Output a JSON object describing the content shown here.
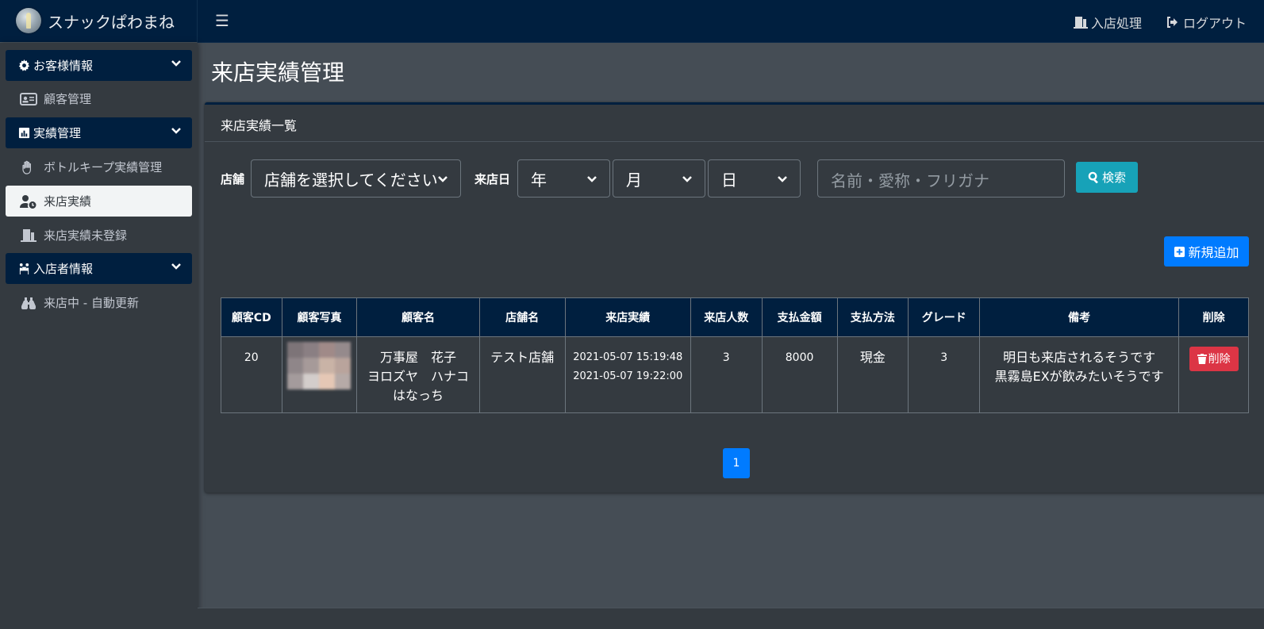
{
  "brand": {
    "name": "スナックぱわまね"
  },
  "topnav": {
    "checkin": "入店処理",
    "logout": "ログアウト"
  },
  "sidebar": {
    "sections": [
      {
        "title": "お客様情報",
        "items": [
          {
            "label": "顧客管理"
          }
        ]
      },
      {
        "title": "実績管理",
        "items": [
          {
            "label": "ボトルキープ実績管理"
          },
          {
            "label": "来店実績"
          },
          {
            "label": "来店実績未登録"
          }
        ]
      },
      {
        "title": "入店者情報",
        "items": [
          {
            "label": "来店中 - 自動更新"
          }
        ]
      }
    ],
    "active_item": "来店実績"
  },
  "page": {
    "title": "来店実績管理",
    "card_title": "来店実績一覧"
  },
  "search": {
    "store_label": "店舗",
    "store_select": "店舗を選択してください",
    "date_label": "来店日",
    "year": "年",
    "month": "月",
    "day": "日",
    "name_placeholder": "名前・愛称・フリガナ",
    "search_button": "検索"
  },
  "add_button": "新規追加",
  "table": {
    "headers": [
      "顧客CD",
      "顧客写真",
      "顧客名",
      "店舗名",
      "来店実績",
      "来店人数",
      "支払金額",
      "支払方法",
      "グレード",
      "備考",
      "削除"
    ],
    "rows": [
      {
        "cd": "20",
        "name_line1": "万事屋　花子",
        "name_line2": "ヨロズヤ　ハナコ",
        "name_line3": "はなっち",
        "store": "テスト店舗",
        "visit_in": "2021-05-07 15:19:48",
        "visit_out": "2021-05-07 19:22:00",
        "people": "3",
        "amount": "8000",
        "payment": "現金",
        "grade": "3",
        "memo_line1": "明日も来店されるそうです",
        "memo_line2": "黒霧島EXが飲みたいそうです",
        "delete_label": "削除"
      }
    ]
  },
  "pagination": {
    "current": "1"
  },
  "colors": {
    "navy": "#001f3f",
    "sidebar": "#343a40",
    "content": "#454d55",
    "info": "#17a2b8",
    "primary": "#007bff",
    "danger": "#dc3545"
  }
}
